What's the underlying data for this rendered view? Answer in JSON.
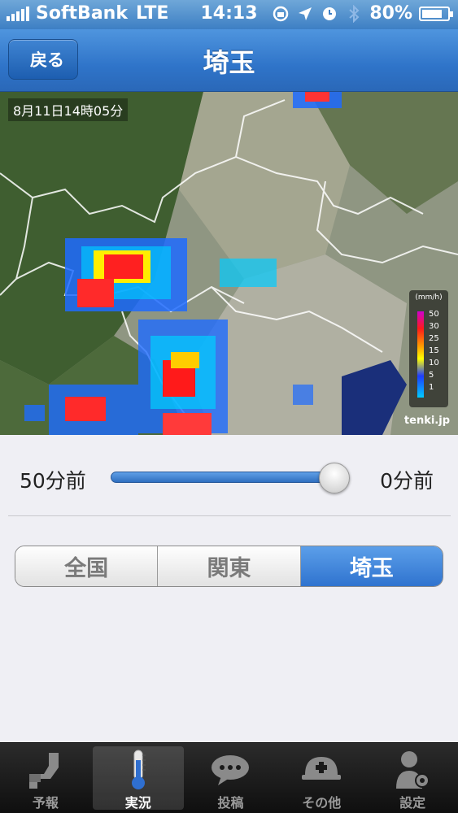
{
  "status_bar": {
    "carrier": "SoftBank",
    "network": "LTE",
    "time": "14:13",
    "battery": "80%",
    "battery_level": 0.8
  },
  "nav": {
    "back_label": "戻る",
    "title": "埼玉"
  },
  "map": {
    "timestamp": "8月11日14時05分",
    "legend_unit": "(mm/h)",
    "legend_values": [
      "50",
      "30",
      "25",
      "15",
      "10",
      "5",
      "1"
    ],
    "watermark": "tenki.jp"
  },
  "slider": {
    "min_label": "50分前",
    "max_label": "0分前",
    "value_fraction": 1.0
  },
  "segments": [
    {
      "label": "全国",
      "active": false
    },
    {
      "label": "関東",
      "active": false
    },
    {
      "label": "埼玉",
      "active": true
    }
  ],
  "tabs": [
    {
      "label": "予報",
      "icon": "forecast-icon",
      "active": false
    },
    {
      "label": "実況",
      "icon": "thermometer-icon",
      "active": true
    },
    {
      "label": "投稿",
      "icon": "speech-bubble-icon",
      "active": false
    },
    {
      "label": "その他",
      "icon": "helmet-icon",
      "active": false
    },
    {
      "label": "設定",
      "icon": "user-gear-icon",
      "active": false
    }
  ]
}
